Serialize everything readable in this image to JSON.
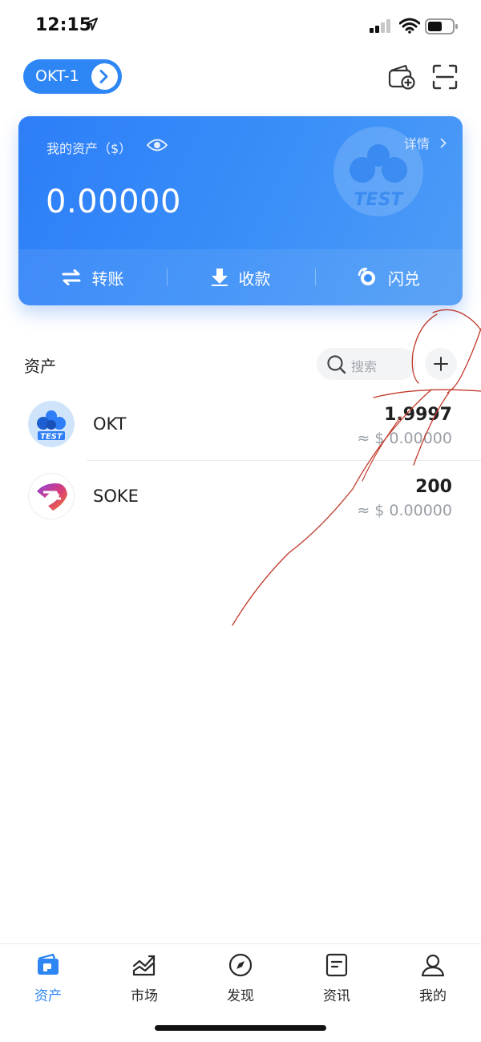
{
  "status_bar": {
    "time": "12:15"
  },
  "header": {
    "network_label": "OKT-1"
  },
  "asset_card": {
    "label": "我的资产（$）",
    "detail_label": "详情",
    "balance": "0.00000",
    "watermark_text": "TEST",
    "actions": [
      {
        "label": "转账"
      },
      {
        "label": "收款"
      },
      {
        "label": "闪兑"
      }
    ]
  },
  "assets": {
    "title": "资产",
    "search_placeholder": "搜索",
    "tokens": [
      {
        "symbol": "OKT",
        "amount": "1.9997",
        "value": "≈ $ 0.00000",
        "logo_text": "TEST"
      },
      {
        "symbol": "SOKE",
        "amount": "200",
        "value": "≈ $ 0.00000"
      }
    ]
  },
  "tab_bar": {
    "active": "资产",
    "tabs": [
      {
        "label": "资产"
      },
      {
        "label": "市场"
      },
      {
        "label": "发现"
      },
      {
        "label": "资讯"
      },
      {
        "label": "我的"
      }
    ]
  },
  "colors": {
    "accent": "#2e86f5",
    "card_start": "#2d7ef8",
    "card_end": "#4e9cf6",
    "scribble": "#c0392b"
  }
}
